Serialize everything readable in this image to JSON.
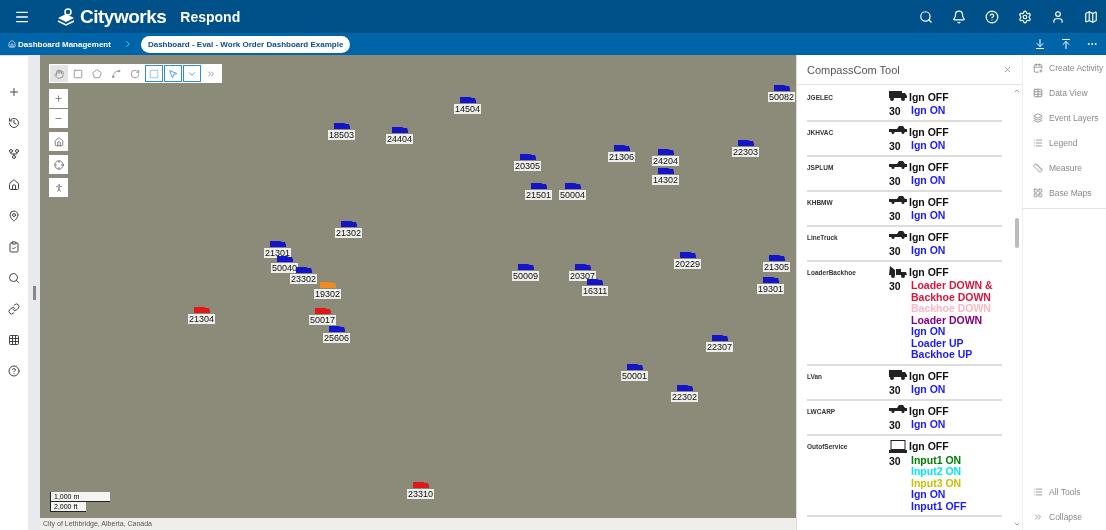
{
  "header": {
    "app_name": "Cityworks",
    "module": "Respond"
  },
  "breadcrumb": [
    {
      "label": "Dashboard Management",
      "selected": false
    },
    {
      "label": "Dashboard - Eval - Work Order Dashboard Example",
      "selected": true
    }
  ],
  "map_tools": [
    {
      "selected": true,
      "active": false
    },
    {
      "selected": false,
      "active": false
    },
    {
      "selected": false,
      "active": false
    },
    {
      "selected": false,
      "active": false
    },
    {
      "selected": false,
      "active": false
    },
    {
      "selected": false,
      "active": true
    },
    {
      "selected": false,
      "active": true
    },
    {
      "selected": false,
      "active": true
    },
    {
      "selected": false,
      "active": false
    }
  ],
  "map": {
    "markers": [
      {
        "label": "14504",
        "color": "#1414c8"
      },
      {
        "label": "18503",
        "color": "#1414c8"
      },
      {
        "label": "24404",
        "color": "#1414c8"
      },
      {
        "label": "50082",
        "color": "#1414c8"
      },
      {
        "label": "20305",
        "color": "#1414c8"
      },
      {
        "label": "21306",
        "color": "#1414c8"
      },
      {
        "label": "24204",
        "color": "#1414c8"
      },
      {
        "label": "14302",
        "color": "#1414c8"
      },
      {
        "label": "22303",
        "color": "#1414c8"
      },
      {
        "label": "21501",
        "color": "#1414c8"
      },
      {
        "label": "50004",
        "color": "#1414c8"
      },
      {
        "label": "21302",
        "color": "#1414c8"
      },
      {
        "label": "21301",
        "color": "#1414c8"
      },
      {
        "label": "50040",
        "color": "#1414c8"
      },
      {
        "label": "23302",
        "color": "#1414c8"
      },
      {
        "label": "19302",
        "color": "#f08c1e"
      },
      {
        "label": "21304",
        "color": "#e01818"
      },
      {
        "label": "50017",
        "color": "#e01818"
      },
      {
        "label": "25606",
        "color": "#1414c8"
      },
      {
        "label": "50009",
        "color": "#1414c8"
      },
      {
        "label": "20307",
        "color": "#1414c8"
      },
      {
        "label": "16311",
        "color": "#1414c8"
      },
      {
        "label": "20229",
        "color": "#1414c8"
      },
      {
        "label": "19301",
        "color": "#1414c8"
      },
      {
        "label": "21305",
        "color": "#1414c8"
      },
      {
        "label": "22307",
        "color": "#1414c8"
      },
      {
        "label": "50001",
        "color": "#1414c8"
      },
      {
        "label": "22302",
        "color": "#1414c8"
      },
      {
        "label": "23310",
        "color": "#e01818"
      }
    ],
    "scale": [
      "1,000 m",
      "2,000 ft"
    ],
    "attribution": "City of Lethbridge, Alberta, Canada"
  },
  "panel": {
    "title": "CompassCom Tool",
    "vehicles": [
      {
        "name": "JGELEC",
        "kind": "van",
        "status": "Ign OFF",
        "count": "30",
        "states": [
          {
            "text": "Ign ON",
            "color": "#1a1aff"
          }
        ]
      },
      {
        "name": "JKHVAC",
        "kind": "pickup",
        "status": "Ign OFF",
        "count": "30",
        "states": [
          {
            "text": "Ign ON",
            "color": "#1a1aff"
          }
        ]
      },
      {
        "name": "JSPLUM",
        "kind": "pickup",
        "status": "Ign OFF",
        "count": "30",
        "states": [
          {
            "text": "Ign ON",
            "color": "#1a1aff"
          }
        ]
      },
      {
        "name": "KHBMW",
        "kind": "pickup",
        "status": "Ign OFF",
        "count": "30",
        "states": [
          {
            "text": "Ign ON",
            "color": "#1a1aff"
          }
        ]
      },
      {
        "name": "LineTruck",
        "kind": "pickup",
        "status": "Ign OFF",
        "count": "30",
        "states": [
          {
            "text": "Ign ON",
            "color": "#1a1aff"
          }
        ]
      },
      {
        "name": "LoaderBackhoe",
        "kind": "loader",
        "status": "Ign OFF",
        "count": "30",
        "states": [
          {
            "text": "Loader DOWN & Backhoe DOWN",
            "color": "#dc143c"
          },
          {
            "text": "Backhoe DOWN",
            "color": "#ffb6c1"
          },
          {
            "text": "Loader DOWN",
            "color": "#800080"
          },
          {
            "text": "Ign ON",
            "color": "#1a1aff"
          },
          {
            "text": "Loader UP",
            "color": "#1a1aff"
          },
          {
            "text": "Backhoe UP",
            "color": "#1a1aff"
          }
        ]
      },
      {
        "name": "LVan",
        "kind": "van",
        "status": "Ign OFF",
        "count": "30",
        "states": [
          {
            "text": "Ign ON",
            "color": "#1a1aff"
          }
        ]
      },
      {
        "name": "LWCARP",
        "kind": "pickup",
        "status": "Ign OFF",
        "count": "30",
        "states": [
          {
            "text": "Ign ON",
            "color": "#1a1aff"
          }
        ]
      },
      {
        "name": "OutofService",
        "kind": "laptop",
        "status": "Ign OFF",
        "count": "30",
        "states": [
          {
            "text": "Input1 ON",
            "color": "#008000"
          },
          {
            "text": "Input2 ON",
            "color": "#00e5ff"
          },
          {
            "text": "Input3 ON",
            "color": "#c8c000"
          },
          {
            "text": "Ign ON",
            "color": "#1a1aff"
          },
          {
            "text": "Input1 OFF",
            "color": "#1a1aff"
          }
        ]
      }
    ]
  },
  "tools": {
    "items": [
      "Create Activity",
      "Data View",
      "Event Layers",
      "Legend",
      "Measure",
      "Base Maps"
    ],
    "footer": [
      "All Tools",
      "Collapse"
    ]
  }
}
